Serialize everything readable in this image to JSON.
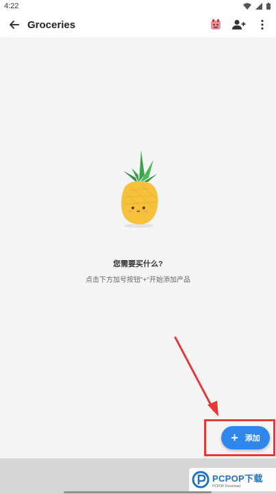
{
  "status_bar": {
    "time": "4:22"
  },
  "app_bar": {
    "title": "Groceries",
    "icons": [
      "arrow-back-icon",
      "sticker-icon",
      "add-person-icon",
      "more-vert-icon"
    ]
  },
  "empty_state": {
    "title": "您需要买什么?",
    "subtitle": "点击下方加号按钮\"+\"开始添加产品"
  },
  "fab": {
    "icon": "+",
    "label": "添加"
  },
  "watermark": {
    "brand": "PCPOP下载",
    "sub": "PCPOP Download"
  },
  "colors": {
    "accent": "#2f86eb",
    "highlight": "#e53935",
    "background": "#f5f5f5"
  }
}
